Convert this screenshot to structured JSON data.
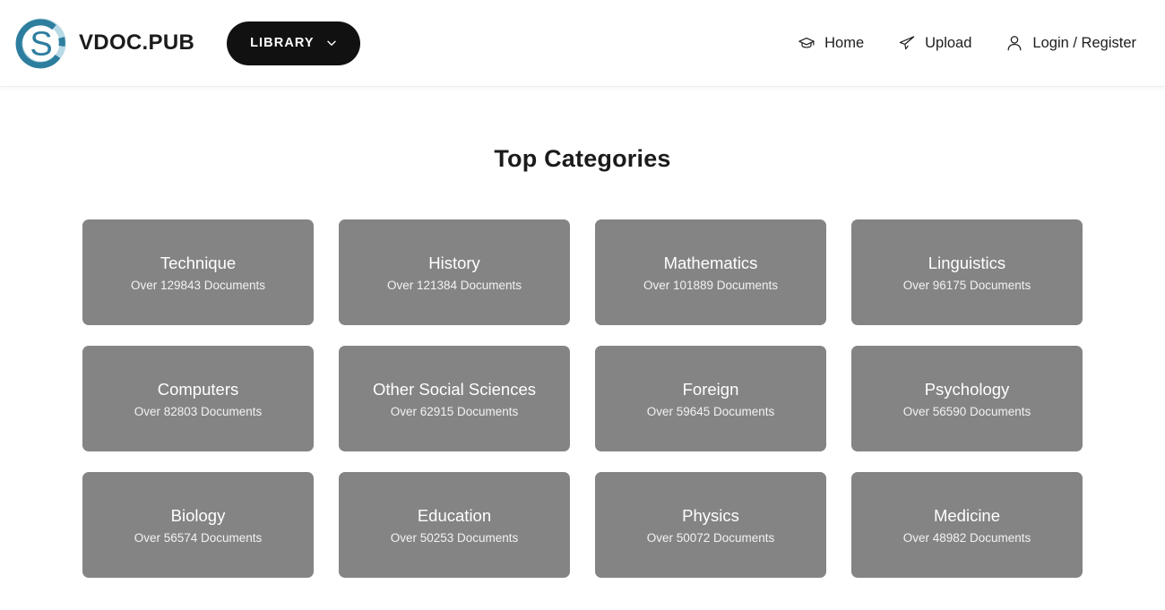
{
  "header": {
    "logo_icon": "vdoc-circle-s-logo",
    "brand_name": "VDOC.PUB",
    "library_button": {
      "label": "LIBRARY",
      "caret_icon": "chevron-down-icon"
    },
    "nav": [
      {
        "label": "Home",
        "icon": "graduation-cap-icon"
      },
      {
        "label": "Upload",
        "icon": "paper-plane-icon"
      },
      {
        "label": "Login / Register",
        "icon": "user-icon"
      }
    ]
  },
  "main": {
    "title": "Top Categories",
    "categories": [
      {
        "name": "Technique",
        "documents": "Over 129843 Documents"
      },
      {
        "name": "History",
        "documents": "Over 121384 Documents"
      },
      {
        "name": "Mathematics",
        "documents": "Over 101889 Documents"
      },
      {
        "name": "Linguistics",
        "documents": "Over 96175 Documents"
      },
      {
        "name": "Computers",
        "documents": "Over 82803 Documents"
      },
      {
        "name": "Other Social Sciences",
        "documents": "Over 62915 Documents"
      },
      {
        "name": "Foreign",
        "documents": "Over 59645 Documents"
      },
      {
        "name": "Psychology",
        "documents": "Over 56590 Documents"
      },
      {
        "name": "Biology",
        "documents": "Over 56574 Documents"
      },
      {
        "name": "Education",
        "documents": "Over 50253 Documents"
      },
      {
        "name": "Physics",
        "documents": "Over 50072 Documents"
      },
      {
        "name": "Medicine",
        "documents": "Over 48982 Documents"
      }
    ]
  },
  "colors": {
    "card_background": "#848484",
    "button_background": "#111111",
    "text_primary": "#1b1b1b",
    "logo_dark_teal": "#2d7d9e",
    "logo_light_teal": "#b8d9e6",
    "page_background": "#ffffff"
  }
}
